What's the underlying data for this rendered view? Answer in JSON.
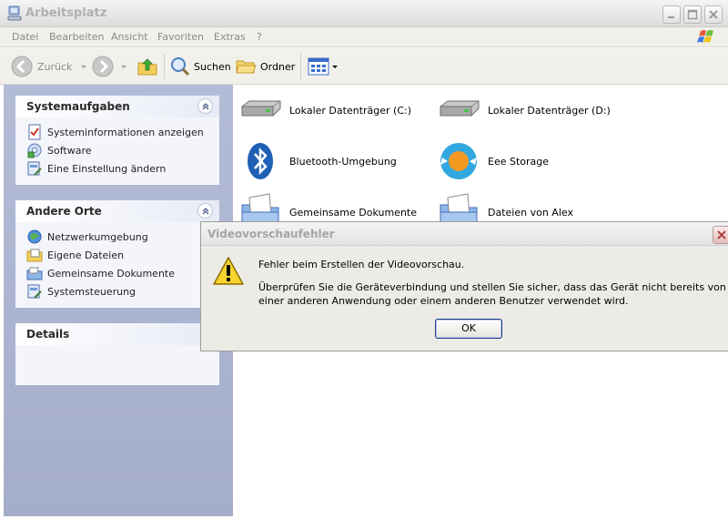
{
  "window": {
    "title": "Arbeitsplatz"
  },
  "menu": {
    "items": [
      "Datei",
      "Bearbeiten",
      "Ansicht",
      "Favoriten",
      "Extras",
      "?"
    ]
  },
  "toolbar": {
    "back_label": "Zurück",
    "search_label": "Suchen",
    "folders_label": "Ordner"
  },
  "sidebar": {
    "system_tasks": {
      "title": "Systemaufgaben",
      "items": [
        "Systeminformationen anzeigen",
        "Software",
        "Eine Einstellung ändern"
      ]
    },
    "other_places": {
      "title": "Andere Orte",
      "items": [
        "Netzwerkumgebung",
        "Eigene Dateien",
        "Gemeinsame Dokumente",
        "Systemsteuerung"
      ]
    },
    "details": {
      "title": "Details"
    }
  },
  "content": {
    "items": [
      {
        "label": "Lokaler Datenträger (C:)",
        "icon": "hard-drive-icon"
      },
      {
        "label": "Lokaler Datenträger (D:)",
        "icon": "hard-drive-icon"
      },
      {
        "label": "Bluetooth-Umgebung",
        "icon": "bluetooth-icon"
      },
      {
        "label": "Eee Storage",
        "icon": "eee-storage-icon"
      },
      {
        "label": "Gemeinsame Dokumente",
        "icon": "shared-folder-icon"
      },
      {
        "label": "Dateien von Alex",
        "icon": "user-folder-icon"
      }
    ]
  },
  "dialog": {
    "title": "Videovorschaufehler",
    "message": "Fehler beim Erstellen der Videovorschau.",
    "detail": "Überprüfen Sie die Geräteverbindung und stellen Sie sicher, dass das Gerät nicht bereits von einer anderen Anwendung oder einem anderen Benutzer verwendet wird.",
    "ok_label": "OK"
  },
  "colors": {
    "task_pane": "#a9b2cf",
    "dialog_bg": "#ecebe6",
    "toolbar_bg": "#f1f0ea"
  }
}
